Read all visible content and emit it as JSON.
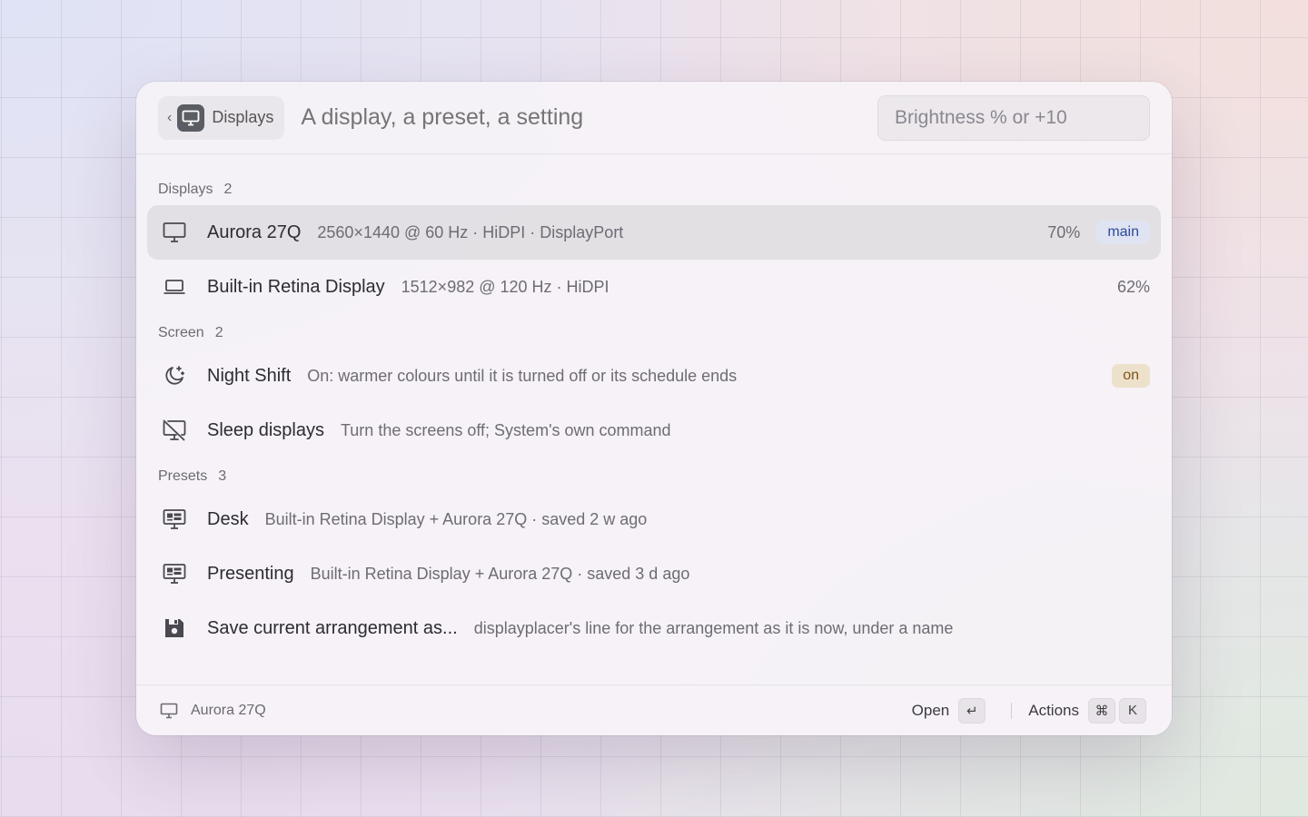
{
  "header": {
    "breadcrumb_label": "Displays",
    "search_placeholder": "A display, a preset, a setting",
    "argument_placeholder": "Brightness % or +10"
  },
  "sections": {
    "displays": {
      "label": "Displays",
      "count": "2",
      "items": [
        {
          "title": "Aurora 27Q",
          "subtitle": "2560×1440 @ 60 Hz · HiDPI · DisplayPort",
          "accessory": "70%",
          "tag": "main",
          "icon": "monitor-icon",
          "selected": true
        },
        {
          "title": "Built-in Retina Display",
          "subtitle": "1512×982 @ 120 Hz · HiDPI",
          "accessory": "62%",
          "icon": "laptop-icon"
        }
      ]
    },
    "screen": {
      "label": "Screen",
      "count": "2",
      "items": [
        {
          "title": "Night Shift",
          "subtitle": "On: warmer colours until it is turned off or its schedule ends",
          "tag": "on",
          "icon": "moon-stars-icon"
        },
        {
          "title": "Sleep displays",
          "subtitle": "Turn the screens off; System's own command",
          "icon": "monitor-off-icon"
        }
      ]
    },
    "presets": {
      "label": "Presets",
      "count": "3",
      "items": [
        {
          "title": "Desk",
          "subtitle": "Built-in Retina Display + Aurora 27Q · saved 2 w ago",
          "icon": "preset-layout-icon"
        },
        {
          "title": "Presenting",
          "subtitle": "Built-in Retina Display + Aurora 27Q · saved 3 d ago",
          "icon": "preset-layout-icon"
        },
        {
          "title": "Save current arrangement as...",
          "subtitle": "displayplacer's line for the arrangement as it is now, under a name",
          "icon": "floppy-disk-icon"
        }
      ]
    }
  },
  "footer": {
    "context_label": "Aurora 27Q",
    "primary_action": "Open",
    "primary_key": "↵",
    "actions_label": "Actions",
    "actions_keys": [
      "⌘",
      "K"
    ]
  },
  "colors": {
    "tag_main_bg": "#dfe3f2",
    "tag_main_fg": "#2d4a9a",
    "tag_on_bg": "#ede1cc",
    "tag_on_fg": "#7a5516"
  }
}
